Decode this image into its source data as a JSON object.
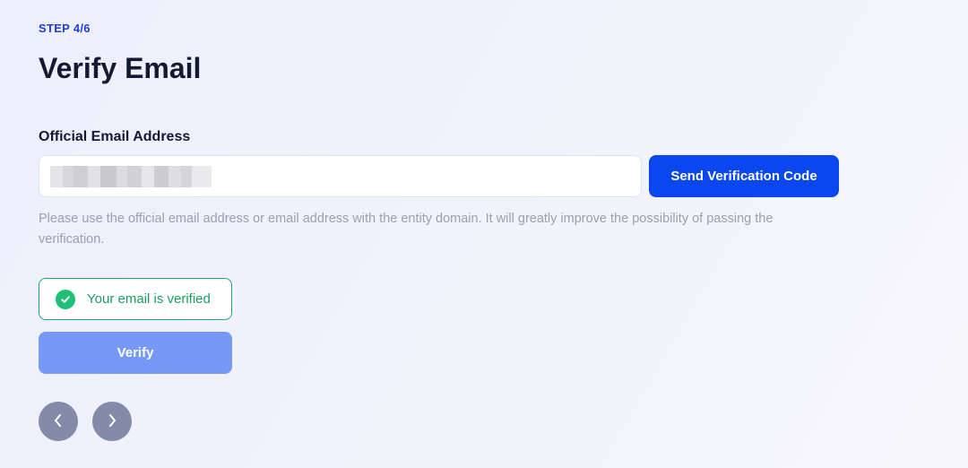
{
  "step": {
    "label": "STEP 4/6"
  },
  "page": {
    "title": "Verify Email"
  },
  "email": {
    "label": "Official Email Address",
    "value": "",
    "send_button_label": "Send Verification Code",
    "hint": "Please use the official email address or email address with the entity domain. It will greatly improve the possibility of passing the verification."
  },
  "status": {
    "verified_text": "Your email is verified",
    "color": "#1a9e60"
  },
  "actions": {
    "verify_label": "Verify",
    "prev_icon": "chevron-left-icon",
    "next_icon": "chevron-right-icon"
  },
  "colors": {
    "accent": "#0a47f0",
    "verify_disabled": "#7699f7",
    "nav": "#848ba9",
    "success": "#1fbf78"
  }
}
